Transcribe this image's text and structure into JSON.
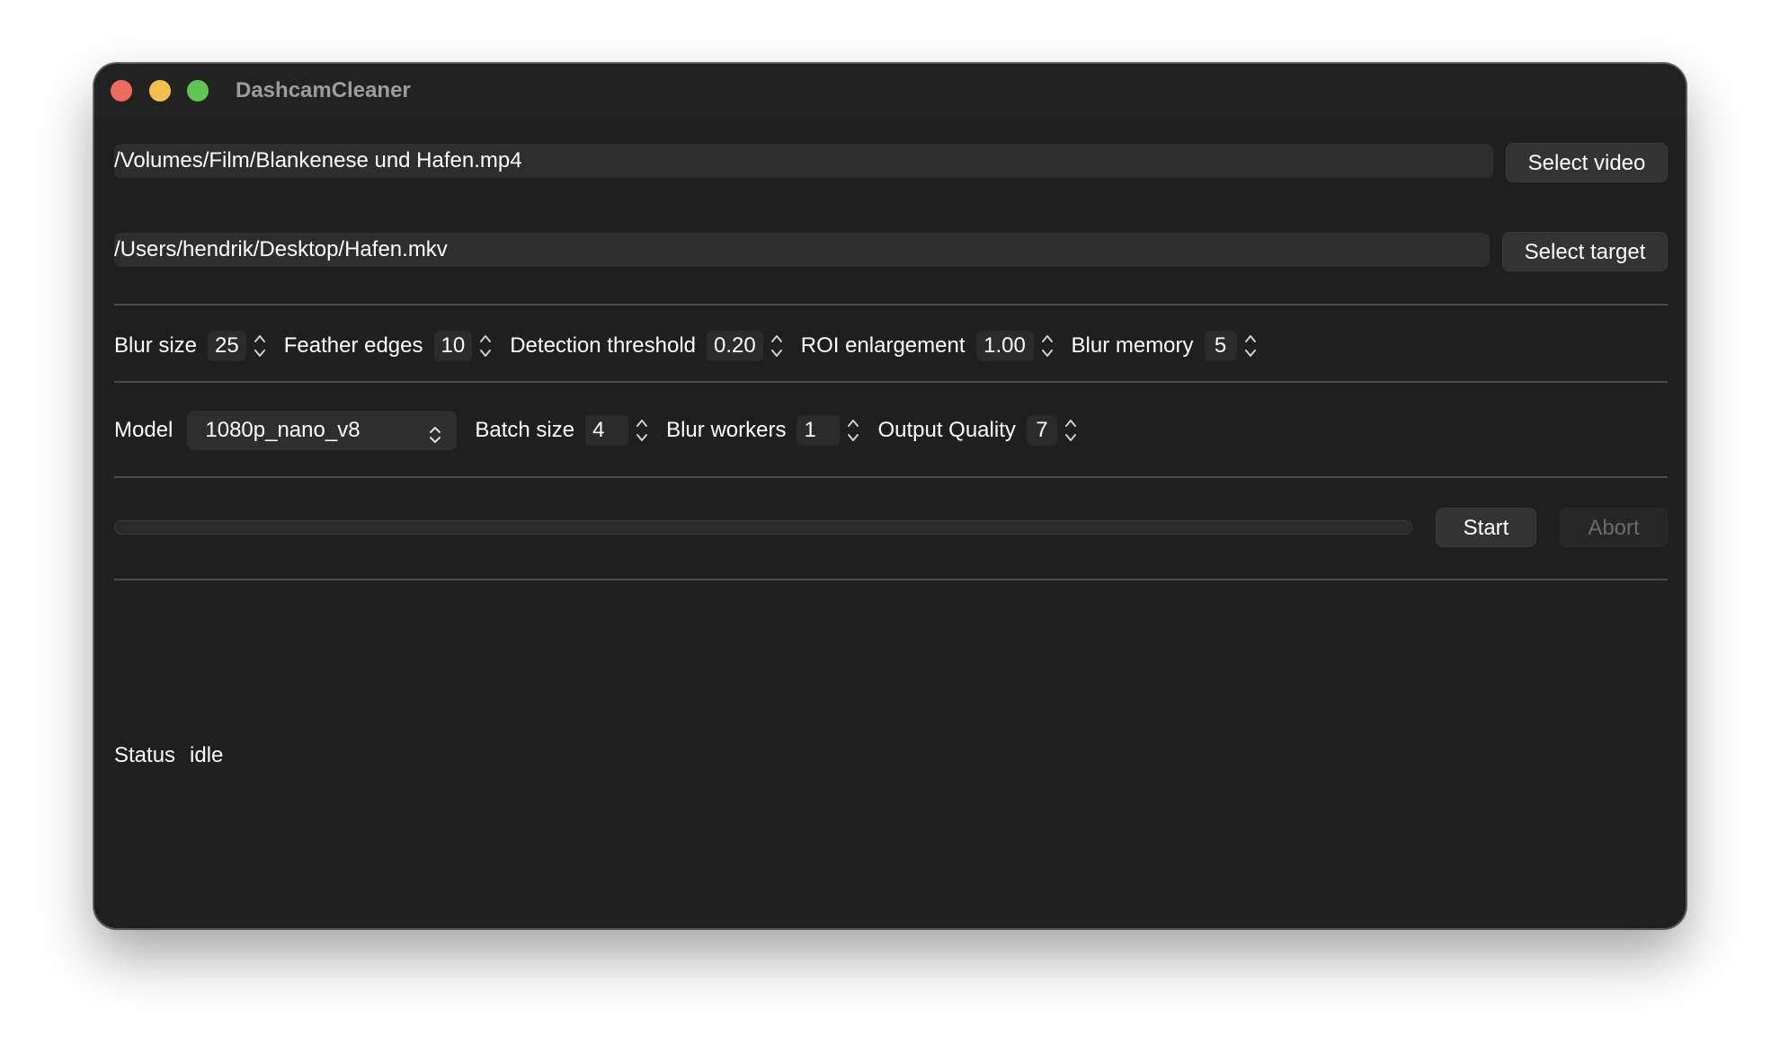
{
  "window": {
    "title": "DashcamCleaner"
  },
  "source": {
    "path": "/Volumes/Film/Blankenese und Hafen.mp4",
    "button": "Select video"
  },
  "target": {
    "path": "/Users/hendrik/Desktop/Hafen.mkv",
    "button": "Select target"
  },
  "blur_settings": {
    "blur_size": {
      "label": "Blur size",
      "value": "25"
    },
    "feather_edges": {
      "label": "Feather edges",
      "value": "10"
    },
    "detection_threshold": {
      "label": "Detection threshold",
      "value": "0.20"
    },
    "roi_enlargement": {
      "label": "ROI enlargement",
      "value": "1.00"
    },
    "blur_memory": {
      "label": "Blur memory",
      "value": "5"
    }
  },
  "model_settings": {
    "model": {
      "label": "Model",
      "value": "1080p_nano_v8"
    },
    "batch_size": {
      "label": "Batch size",
      "value": "4"
    },
    "blur_workers": {
      "label": "Blur workers",
      "value": "1"
    },
    "output_quality": {
      "label": "Output Quality",
      "value": "7"
    }
  },
  "progress": {
    "value": 0
  },
  "controls": {
    "start": "Start",
    "abort": "Abort",
    "abort_enabled": false
  },
  "status": {
    "label": "Status",
    "value": "idle"
  },
  "colors": {
    "window_bg": "#1f1f1f",
    "accent": "#0a84ff",
    "close": "#ec6a5e",
    "minimize": "#f4bf4f",
    "maximize": "#61c554"
  }
}
